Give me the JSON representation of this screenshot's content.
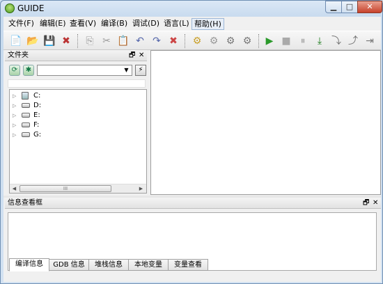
{
  "window": {
    "title": "GUIDE",
    "controls": {
      "minimize": "▁",
      "maximize": "□",
      "close": "✕"
    }
  },
  "menubar": {
    "items": [
      {
        "label": "文件(F)"
      },
      {
        "label": "编辑(E)"
      },
      {
        "label": "查看(V)"
      },
      {
        "label": "编译(B)"
      },
      {
        "label": "调试(D)"
      },
      {
        "label": "语言(L)"
      },
      {
        "label": "帮助(H)"
      }
    ]
  },
  "toolbar": {
    "buttons": [
      {
        "name": "new-file-icon",
        "glyph": "📄"
      },
      {
        "name": "open-folder-icon",
        "glyph": "📂"
      },
      {
        "name": "save-icon",
        "glyph": "💾"
      },
      {
        "name": "close-file-icon",
        "glyph": "✖"
      },
      {
        "name": "copy-icon",
        "glyph": "⎘"
      },
      {
        "name": "cut-icon",
        "glyph": "✂"
      },
      {
        "name": "paste-icon",
        "glyph": "📋"
      },
      {
        "name": "undo-icon",
        "glyph": "↶"
      },
      {
        "name": "redo-icon",
        "glyph": "↷"
      },
      {
        "name": "tools-icon",
        "glyph": "✖"
      },
      {
        "name": "compile-icon",
        "glyph": "⚙"
      },
      {
        "name": "build-icon",
        "glyph": "⚙"
      },
      {
        "name": "settings-gear-icon",
        "glyph": "⚙"
      },
      {
        "name": "settings-gears-icon",
        "glyph": "⚙"
      },
      {
        "name": "run-icon",
        "glyph": "▶"
      },
      {
        "name": "stop-icon",
        "glyph": "■"
      },
      {
        "name": "pause-icon",
        "glyph": "⏸"
      },
      {
        "name": "step-into-icon",
        "glyph": "⤓"
      },
      {
        "name": "step-over-icon",
        "glyph": "⤵"
      },
      {
        "name": "step-out-icon",
        "glyph": "⤴"
      },
      {
        "name": "run-to-cursor-icon",
        "glyph": "⇥"
      }
    ]
  },
  "file_panel": {
    "title": "文件夹",
    "pin_icon": "🗗",
    "close_icon": "✕",
    "combo_value": "",
    "tree": [
      {
        "label": "C:",
        "type": "system"
      },
      {
        "label": "D:",
        "type": "drive"
      },
      {
        "label": "E:",
        "type": "drive"
      },
      {
        "label": "F:",
        "type": "drive"
      },
      {
        "label": "G:",
        "type": "drive"
      }
    ],
    "scroll_thumb_grip": "III"
  },
  "info_panel": {
    "title": "信息查看框",
    "pin_icon": "🗗",
    "close_icon": "✕",
    "tabs": [
      {
        "label": "编译信息",
        "active": true
      },
      {
        "label": "GDB 信息",
        "active": false
      },
      {
        "label": "堆栈信息",
        "active": false
      },
      {
        "label": "本地变量",
        "active": false
      },
      {
        "label": "变量查看",
        "active": false
      }
    ]
  }
}
